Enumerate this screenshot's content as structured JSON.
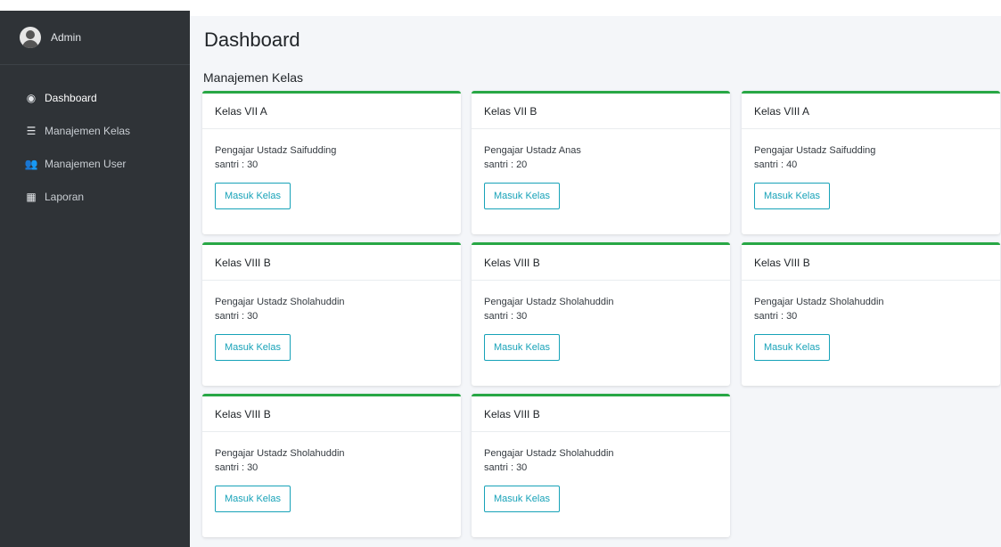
{
  "sidebar": {
    "user_name": "Admin",
    "items": [
      {
        "label": "Dashboard",
        "icon": "tachometer-icon"
      },
      {
        "label": "Manajemen Kelas",
        "icon": "list-icon"
      },
      {
        "label": "Manajemen User",
        "icon": "users-icon"
      },
      {
        "label": "Laporan",
        "icon": "grid-icon"
      }
    ]
  },
  "main": {
    "title": "Dashboard",
    "section_title": "Manajemen Kelas",
    "cards": [
      {
        "class_name": "Kelas VII A",
        "teacher": "Pengajar Ustadz Saifudding",
        "santri": "santri : 30",
        "button": "Masuk Kelas"
      },
      {
        "class_name": "Kelas VII B",
        "teacher": "Pengajar Ustadz Anas",
        "santri": "santri : 20",
        "button": "Masuk Kelas"
      },
      {
        "class_name": "Kelas VIII A",
        "teacher": "Pengajar Ustadz Saifudding",
        "santri": "santri : 40",
        "button": "Masuk Kelas"
      },
      {
        "class_name": "Kelas VIII B",
        "teacher": "Pengajar Ustadz Sholahuddin",
        "santri": "santri : 30",
        "button": "Masuk Kelas"
      },
      {
        "class_name": "Kelas VIII B",
        "teacher": "Pengajar Ustadz Sholahuddin",
        "santri": "santri : 30",
        "button": "Masuk Kelas"
      },
      {
        "class_name": "Kelas VIII B",
        "teacher": "Pengajar Ustadz Sholahuddin",
        "santri": "santri : 30",
        "button": "Masuk Kelas"
      },
      {
        "class_name": "Kelas VIII B",
        "teacher": "Pengajar Ustadz Sholahuddin",
        "santri": "santri : 30",
        "button": "Masuk Kelas"
      },
      {
        "class_name": "Kelas VIII B",
        "teacher": "Pengajar Ustadz Sholahuddin",
        "santri": "santri : 30",
        "button": "Masuk Kelas"
      }
    ]
  },
  "colors": {
    "sidebar_bg": "#2f3337",
    "card_accent": "#28a745",
    "button_accent": "#17a2b8",
    "content_bg": "#f4f6f9"
  }
}
